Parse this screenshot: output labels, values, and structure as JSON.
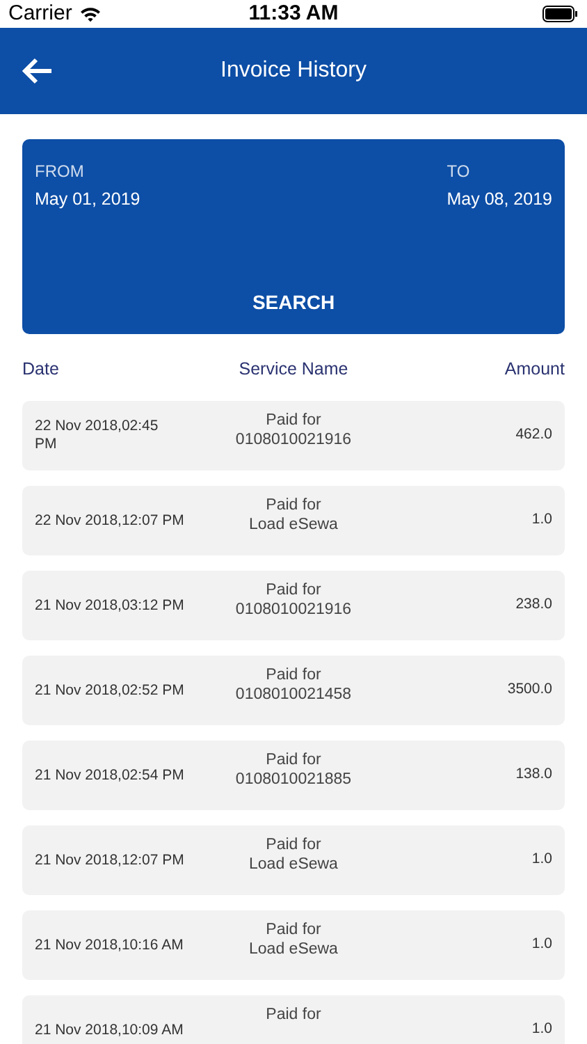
{
  "status_bar": {
    "carrier": "Carrier",
    "time": "11:33 AM"
  },
  "header": {
    "title": "Invoice History"
  },
  "date_range": {
    "from_label": "FROM",
    "from_value": "May 01, 2019",
    "to_label": "TO",
    "to_value": "May 08, 2019",
    "button": "SEARCH"
  },
  "table": {
    "columns": [
      "Date",
      "Service Name",
      "Amount"
    ],
    "rows": [
      {
        "date": [
          "22 Nov 2018,02:45",
          "PM"
        ],
        "service": [
          "Paid for",
          "0108010021916"
        ],
        "amount": "462.0"
      },
      {
        "date": [
          "22 Nov 2018,12:07 PM"
        ],
        "service": [
          "Paid for",
          "Load eSewa"
        ],
        "amount": "1.0"
      },
      {
        "date": [
          "21 Nov 2018,03:12 PM"
        ],
        "service": [
          "Paid for",
          "0108010021916"
        ],
        "amount": "238.0"
      },
      {
        "date": [
          "21 Nov 2018,02:52 PM"
        ],
        "service": [
          "Paid for",
          "0108010021458"
        ],
        "amount": "3500.0"
      },
      {
        "date": [
          "21 Nov 2018,02:54 PM"
        ],
        "service": [
          "Paid for",
          "0108010021885"
        ],
        "amount": "138.0"
      },
      {
        "date": [
          "21 Nov 2018,12:07 PM"
        ],
        "service": [
          "Paid for",
          "Load eSewa"
        ],
        "amount": "1.0"
      },
      {
        "date": [
          "21 Nov 2018,10:16 AM"
        ],
        "service": [
          "Paid for",
          "Load eSewa"
        ],
        "amount": "1.0"
      },
      {
        "date": [
          "21 Nov 2018,10:09 AM"
        ],
        "service": [
          "Paid for"
        ],
        "amount": "1.0"
      }
    ]
  }
}
